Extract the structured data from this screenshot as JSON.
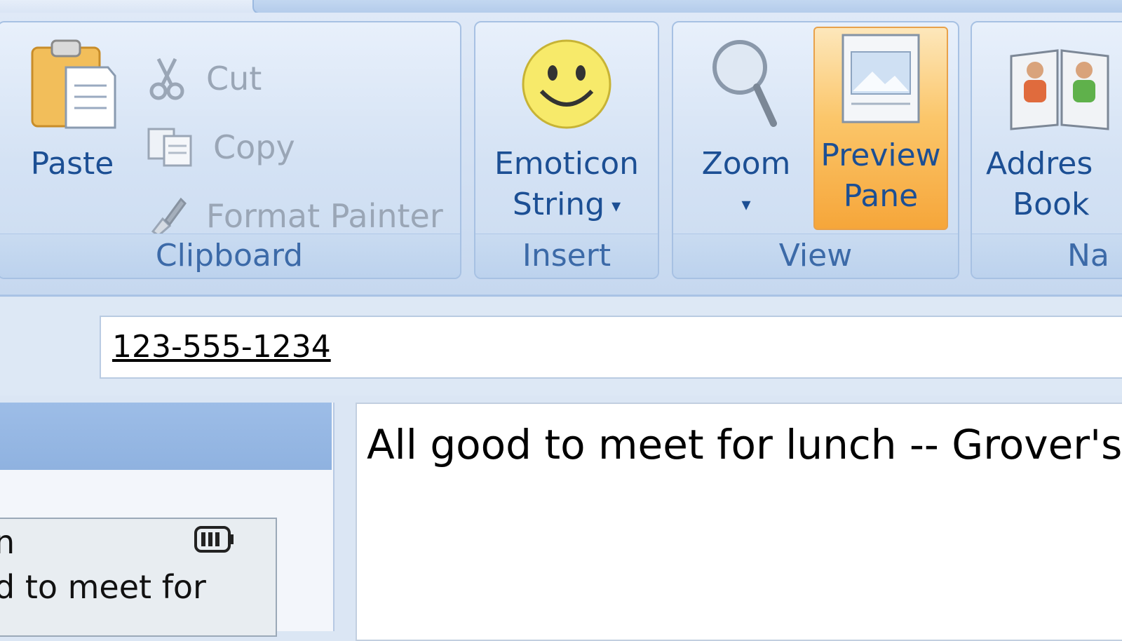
{
  "ribbon": {
    "clipboard": {
      "label": "Clipboard",
      "paste": "Paste",
      "cut": "Cut",
      "copy": "Copy",
      "format_painter": "Format Painter"
    },
    "insert": {
      "label": "Insert",
      "emoticon_line1": "Emoticon",
      "emoticon_line2": "String",
      "caret": "▾"
    },
    "view": {
      "label": "View",
      "zoom": "Zoom",
      "zoom_caret": "▾",
      "preview_line1": "Preview",
      "preview_line2": "Pane"
    },
    "names": {
      "label": "Na",
      "address_line1": "Addres",
      "address_line2": "Book"
    }
  },
  "phone_field": {
    "value": "123-555-1234"
  },
  "left_panel": {
    "card_top": "n",
    "card_text": "d to meet for"
  },
  "message": {
    "text": "All good to meet for lunch -- Grover's a"
  },
  "icons": {
    "paste": "clipboard-paste-icon",
    "cut": "scissors-icon",
    "copy": "copy-icon",
    "format_painter": "paintbrush-icon",
    "emoticon": "smiley-icon",
    "zoom": "magnifier-icon",
    "preview": "preview-pane-icon",
    "address_book": "address-book-icon",
    "battery": "battery-icon"
  },
  "colors": {
    "accent_blue": "#1c4f94",
    "group_label": "#3c6aa8",
    "active_orange": "#f6a63a",
    "disabled_gray": "#9aa6b6"
  }
}
